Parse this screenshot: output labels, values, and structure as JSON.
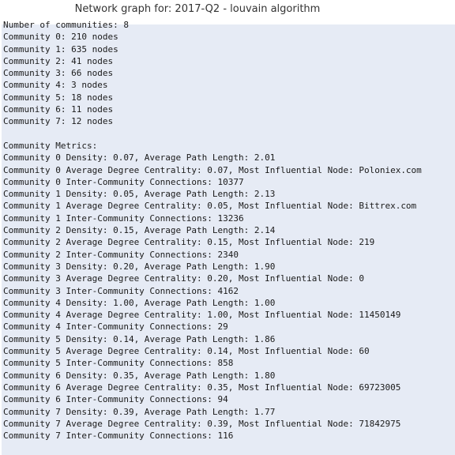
{
  "title": "Network graph for: 2017-Q2 - louvain algorithm",
  "output_lines": [
    "Number of communities: 8",
    "Community 0: 210 nodes",
    "Community 1: 635 nodes",
    "Community 2: 41 nodes",
    "Community 3: 66 nodes",
    "Community 4: 3 nodes",
    "Community 5: 18 nodes",
    "Community 6: 11 nodes",
    "Community 7: 12 nodes",
    "",
    "Community Metrics:",
    "Community 0 Density: 0.07, Average Path Length: 2.01",
    "Community 0 Average Degree Centrality: 0.07, Most Influential Node: Poloniex.com",
    "Community 0 Inter-Community Connections: 10377",
    "Community 1 Density: 0.05, Average Path Length: 2.13",
    "Community 1 Average Degree Centrality: 0.05, Most Influential Node: Bittrex.com",
    "Community 1 Inter-Community Connections: 13236",
    "Community 2 Density: 0.15, Average Path Length: 2.14",
    "Community 2 Average Degree Centrality: 0.15, Most Influential Node: 219",
    "Community 2 Inter-Community Connections: 2340",
    "Community 3 Density: 0.20, Average Path Length: 1.90",
    "Community 3 Average Degree Centrality: 0.20, Most Influential Node: 0",
    "Community 3 Inter-Community Connections: 4162",
    "Community 4 Density: 1.00, Average Path Length: 1.00",
    "Community 4 Average Degree Centrality: 1.00, Most Influential Node: 11450149",
    "Community 4 Inter-Community Connections: 29",
    "Community 5 Density: 0.14, Average Path Length: 1.86",
    "Community 5 Average Degree Centrality: 0.14, Most Influential Node: 60",
    "Community 5 Inter-Community Connections: 858",
    "Community 6 Density: 0.35, Average Path Length: 1.80",
    "Community 6 Average Degree Centrality: 0.35, Most Influential Node: 69723005",
    "Community 6 Inter-Community Connections: 94",
    "Community 7 Density: 0.39, Average Path Length: 1.77",
    "Community 7 Average Degree Centrality: 0.39, Most Influential Node: 71842975",
    "Community 7 Inter-Community Connections: 116"
  ]
}
